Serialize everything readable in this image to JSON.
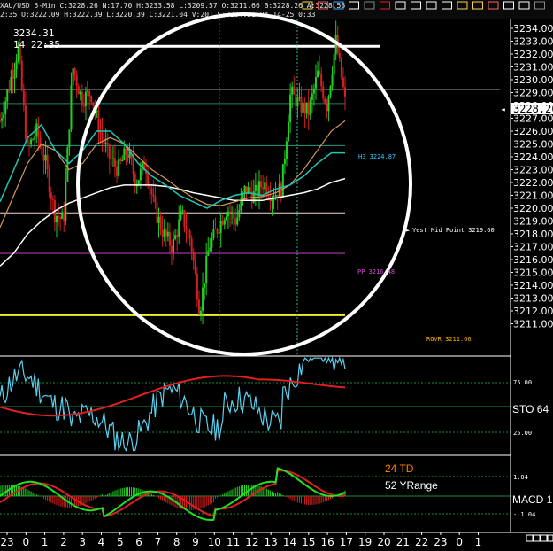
{
  "header": {
    "line1": "XAU/USD  5-Min  C:3228.26  N:17.70  H:3233.58  L:3209.57  O:3211.66  B:3228.26  A:3228.56",
    "line2": "2:35  O:3222.09  H:3222.39  L:3220.39  C:3221.04  V:201  S:3234.31  04-14-25  0:33",
    "toolbar_icons": [
      "notepad-icon",
      "rainbow-icon",
      "pencil-icon",
      "pen-icon",
      "divider-icon",
      "no-entry-icon",
      "line-tool-icon",
      "fib-icon",
      "hline-icon",
      "ray-icon",
      "sign-icon",
      "hilite-icon",
      "arrow-up-icon",
      "text-icon",
      "zoom-icon",
      "grid-icon"
    ]
  },
  "price_readout": {
    "value": "3234.31",
    "time": "14 22:35"
  },
  "current_price": {
    "label": "3228.26",
    "value": 3228.26
  },
  "price_axis": {
    "ticks": [
      "3234.00",
      "3233.00",
      "3232.00",
      "3231.00",
      "3230.00",
      "3229.00",
      "3228.00",
      "3227.00",
      "3226.00",
      "3225.00",
      "3224.00",
      "3223.00",
      "3222.00",
      "3221.00",
      "3220.00",
      "3219.00",
      "3218.00",
      "3217.00",
      "3216.00",
      "3215.00",
      "3214.00",
      "3213.00",
      "3212.00",
      "3211.00"
    ]
  },
  "sto_panel": {
    "label": "STO",
    "value": "64",
    "level_high": "75.00",
    "level_low": "25.00"
  },
  "macd_panel": {
    "label": "MACD",
    "value": "1",
    "level_pos": "1.04",
    "level_neg": "- 1.04",
    "td_text": "24 TD",
    "range_text": "52 YRange"
  },
  "annotations": {
    "h3": "H3  3224.87",
    "yest_mid": "Yest Mid Point  3219.60",
    "pp": "PP  3216.48",
    "rovr": "ROVR  3211.66"
  },
  "x_axis": {
    "labels": [
      "23",
      "0",
      "1",
      "2",
      "3",
      "4",
      "5",
      "6",
      "7",
      "8",
      "9",
      "10",
      "11",
      "12",
      "13",
      "14",
      "15",
      "16",
      "17",
      "19",
      "20",
      "21",
      "22",
      "23",
      "0",
      "1"
    ]
  },
  "colors": {
    "background": "#000000",
    "up_candle": "#22d022",
    "down_candle": "#d42020",
    "sto_line": "#5ad0ee",
    "sto_signal": "#e02020",
    "ma_white": "#ffffff",
    "ma_teal": "#1fc7b3",
    "ma_orange": "#d39a5a",
    "yest_mid_line": "#f3d8cf",
    "pp_line": "#c33ec3",
    "rovr_line": "#f1f12a",
    "h3_line": "#2d9a86",
    "grid_white": "#ffffff",
    "macd_green": "#22e022",
    "macd_red": "#e02020",
    "td_orange": "#ff8000"
  },
  "chart_data": {
    "type": "candlestick",
    "symbol": "XAU/USD",
    "timeframe": "5-Min",
    "ylim": [
      3210.6,
      3234.6
    ],
    "x_hour_labels": [
      "23",
      "0",
      "1",
      "2",
      "3",
      "4",
      "5",
      "6",
      "7",
      "8",
      "9",
      "10",
      "11",
      "12",
      "13",
      "14",
      "15",
      "16",
      "17",
      "19",
      "20",
      "21",
      "22",
      "23",
      "0",
      "1"
    ],
    "close_path": [
      3226.8,
      3229.5,
      3232.5,
      3224.5,
      3226.0,
      3223.6,
      3219.6,
      3219.0,
      3231.0,
      3228.5,
      3229.0,
      3226.0,
      3224.0,
      3223.0,
      3224.5,
      3222.0,
      3223.5,
      3220.0,
      3218.0,
      3217.0,
      3219.5,
      3217.5,
      3212.0,
      3217.0,
      3218.5,
      3220.0,
      3219.0,
      3221.5,
      3221.0,
      3222.0,
      3221.0,
      3221.5,
      3229.0,
      3228.0,
      3227.5,
      3230.5,
      3228.0,
      3233.0,
      3228.3
    ],
    "ma_white": [
      3215.5,
      3216.5,
      3218.0,
      3219.0,
      3219.8,
      3220.4,
      3220.8,
      3221.2,
      3221.6,
      3221.8,
      3221.8,
      3221.8,
      3221.7,
      3221.5,
      3221.2,
      3221.0,
      3220.8,
      3220.6,
      3220.6,
      3220.6,
      3220.8,
      3221.0,
      3221.2,
      3221.5,
      3222.0,
      3222.3
    ],
    "ma_teal": [
      3220.5,
      3223.0,
      3225.5,
      3226.5,
      3224.5,
      3223.5,
      3224.5,
      3226.0,
      3226.0,
      3225.0,
      3223.5,
      3222.5,
      3221.8,
      3221.0,
      3220.5,
      3220.0,
      3220.6,
      3221.0,
      3221.2,
      3221.0,
      3221.5,
      3221.8,
      3222.5,
      3223.5,
      3224.3,
      3224.3
    ],
    "ma_orange": [
      3218.5,
      3221.0,
      3223.5,
      3225.0,
      3224.5,
      3223.0,
      3223.5,
      3225.0,
      3225.5,
      3225.0,
      3224.0,
      3223.0,
      3222.3,
      3221.5,
      3220.8,
      3220.3,
      3220.2,
      3220.5,
      3220.8,
      3220.9,
      3221.2,
      3221.8,
      3223.0,
      3224.5,
      3226.0,
      3226.8
    ],
    "levels": {
      "h3": 3224.87,
      "yest_mid": 3219.6,
      "pp": 3216.48,
      "rovr": 3211.66,
      "top_line": 3232.6
    },
    "sto": {
      "levels": [
        75,
        25
      ],
      "last": 64
    },
    "macd": {
      "levels": [
        1.04,
        -1.04
      ]
    }
  }
}
